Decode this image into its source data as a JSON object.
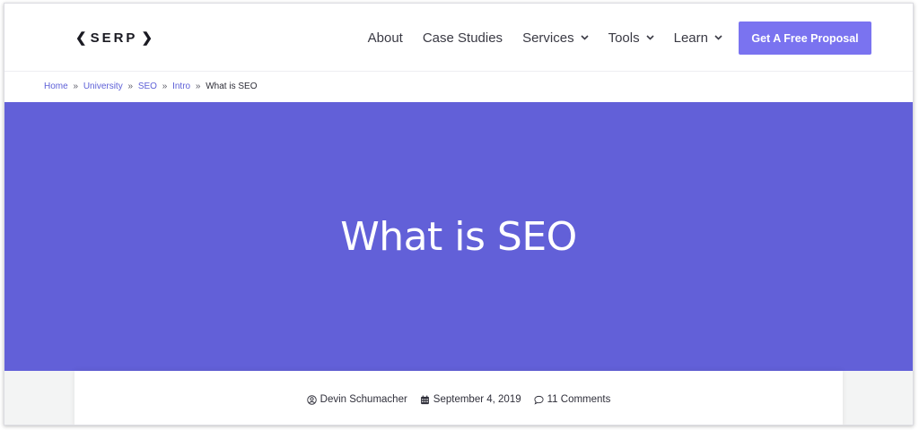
{
  "header": {
    "logo": {
      "left_glyph": "❮",
      "text": "SERP",
      "right_glyph": "❯"
    },
    "nav": [
      {
        "label": "About",
        "has_caret": false
      },
      {
        "label": "Case Studies",
        "has_caret": false
      },
      {
        "label": "Services",
        "has_caret": true
      },
      {
        "label": "Tools",
        "has_caret": true
      },
      {
        "label": "Learn",
        "has_caret": true
      }
    ],
    "cta_label": "Get A Free Proposal",
    "caret_icon": "chevron-down-icon"
  },
  "breadcrumb": {
    "items": [
      "Home",
      "University",
      "SEO",
      "Intro"
    ],
    "current": "What is SEO",
    "separator": "»"
  },
  "hero": {
    "title": "What is SEO",
    "bg_color": "#6260d8"
  },
  "meta": {
    "author": "Devin Schumacher",
    "date": "September 4, 2019",
    "comments": "11 Comments"
  },
  "colors": {
    "accent": "#7a73f0",
    "link": "#5d5fd7"
  }
}
